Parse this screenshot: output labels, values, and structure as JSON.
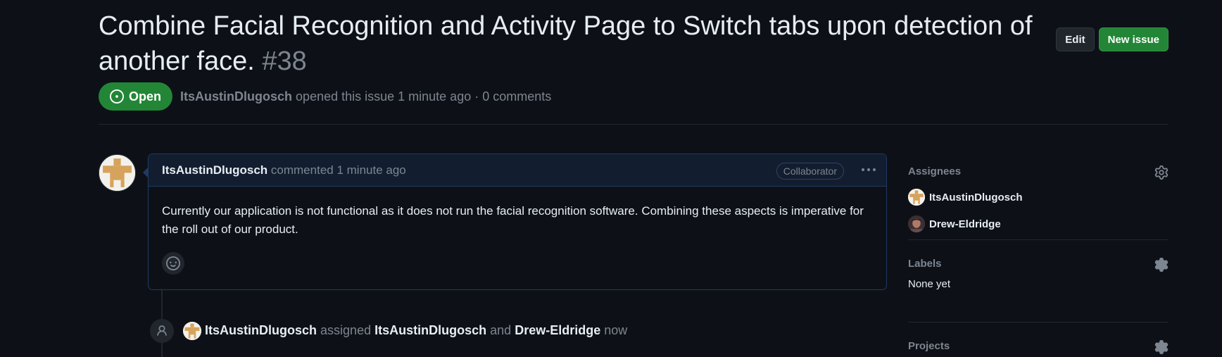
{
  "issue": {
    "title": "Combine Facial Recognition and Activity Page to Switch tabs upon detection of another face.",
    "number": "#38",
    "state": "Open",
    "author": "ItsAustinDlugosch",
    "meta_suffix": "opened this issue 1 minute ago · 0 comments"
  },
  "header": {
    "edit_label": "Edit",
    "new_issue_label": "New issue"
  },
  "comment": {
    "author": "ItsAustinDlugosch",
    "action": "commented 1 minute ago",
    "role_badge": "Collaborator",
    "body": "Currently our application is not functional as it does not run the facial recognition software. Combining these aspects is imperative for the roll out of our product."
  },
  "timeline": {
    "actor": "ItsAustinDlugosch",
    "verb": "assigned",
    "assignee1": "ItsAustinDlugosch",
    "conjunction": "and",
    "assignee2": "Drew-Eldridge",
    "time": "now"
  },
  "sidebar": {
    "assignees_title": "Assignees",
    "assignees": [
      {
        "name": "ItsAustinDlugosch"
      },
      {
        "name": "Drew-Eldridge"
      }
    ],
    "labels_title": "Labels",
    "labels_value": "None yet",
    "projects_title": "Projects"
  },
  "colors": {
    "background": "#0d1117",
    "open_green": "#238636",
    "comment_border": "#1f3a63",
    "muted_text": "#7d8590"
  },
  "icons": {
    "state": "issue-opened-icon",
    "kebab": "kebab-horizontal-icon",
    "emoji": "smiley-icon",
    "timeline": "person-icon",
    "settings": "gear-icon"
  }
}
